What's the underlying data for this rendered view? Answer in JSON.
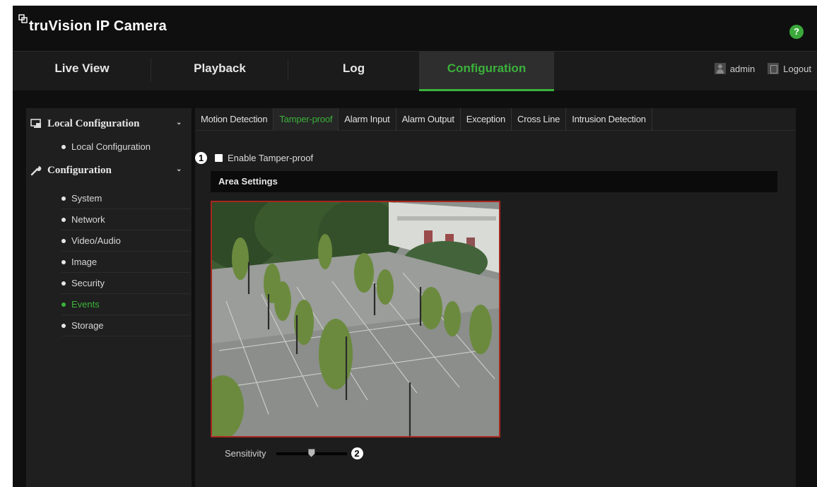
{
  "brand": {
    "name": "truVision IP Camera"
  },
  "header": {
    "help_label": "?"
  },
  "topnav": {
    "items": [
      {
        "label": "Live View"
      },
      {
        "label": "Playback"
      },
      {
        "label": "Log"
      },
      {
        "label": "Configuration"
      }
    ],
    "active": "Configuration",
    "user": "admin",
    "logout": "Logout"
  },
  "sidebar": {
    "groups": [
      {
        "label": "Local Configuration",
        "icon": "monitor-icon",
        "items": [
          {
            "label": "Local Configuration"
          }
        ]
      },
      {
        "label": "Configuration",
        "icon": "wrench-icon",
        "items": [
          {
            "label": "System"
          },
          {
            "label": "Network"
          },
          {
            "label": "Video/Audio"
          },
          {
            "label": "Image"
          },
          {
            "label": "Security"
          },
          {
            "label": "Events"
          },
          {
            "label": "Storage"
          }
        ]
      }
    ],
    "active_item": "Events"
  },
  "main": {
    "tabs": [
      {
        "label": "Motion Detection"
      },
      {
        "label": "Tamper-proof"
      },
      {
        "label": "Alarm Input"
      },
      {
        "label": "Alarm Output"
      },
      {
        "label": "Exception"
      },
      {
        "label": "Cross Line"
      },
      {
        "label": "Intrusion Detection"
      }
    ],
    "active_tab": "Tamper-proof",
    "enable": {
      "marker": "1",
      "label": "Enable Tamper-proof",
      "checked": false
    },
    "area_settings_title": "Area Settings",
    "sensitivity": {
      "label": "Sensitivity",
      "value_fraction": 0.5,
      "marker": "2"
    }
  },
  "colors": {
    "accent": "#3bb23b",
    "video_border": "#a8271f",
    "background": "#0f0f0f"
  }
}
